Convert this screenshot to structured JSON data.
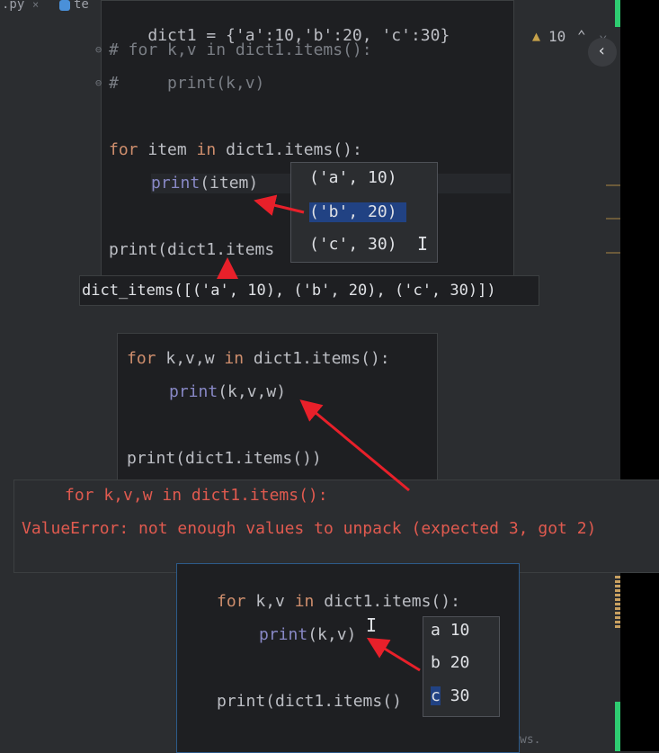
{
  "tabs": [
    {
      "label": ".py"
    },
    {
      "label": "te"
    }
  ],
  "inspection": {
    "warn_count": "10"
  },
  "panel1": {
    "l1": "dict1 = {'a':10,'b':20, 'c':30}",
    "l2": "# for k,v in dict1.items():",
    "l3": "#     print(k,v)",
    "l4_kw": "for",
    "l4_rest": " item ",
    "l4_in": "in",
    "l4_tail": " dict1.items():",
    "l5_pr": "print",
    "l5_rest": "(item)",
    "l6": "print(dict1.items"
  },
  "popup1": {
    "items": [
      {
        "label": "('a', 10)"
      },
      {
        "label": "('b', 20)"
      },
      {
        "label": "('c', 30)"
      }
    ]
  },
  "output1": {
    "text": "dict_items([('a', 10), ('b', 20), ('c', 30)])"
  },
  "panel2": {
    "l1_kw": "for",
    "l1_rest": " k,v,w ",
    "l1_in": "in",
    "l1_tail": " dict1.items():",
    "l2_pr": "print",
    "l2_rest": "(k,v,w)",
    "l3": "print(dict1.items())"
  },
  "error": {
    "line1": "for k,v,w in dict1.items():",
    "line2": "ValueError: not enough values to unpack (expected 3, got 2)"
  },
  "panel3": {
    "l1_kw": "for",
    "l1_rest": " k,v ",
    "l1_in": "in",
    "l1_tail": " dict1.items():",
    "l2_pr": "print",
    "l2_rest": "(k,v)",
    "l3": "print(dict1.items()"
  },
  "popup3": {
    "items": [
      {
        "k": "a",
        "v": "10"
      },
      {
        "k": "b",
        "v": "20"
      },
      {
        "k": "c",
        "v": "30"
      }
    ]
  },
  "status": {
    "text": "ws."
  },
  "colors": {
    "arrow": "#e8202a",
    "accent": "#2ecc71"
  }
}
